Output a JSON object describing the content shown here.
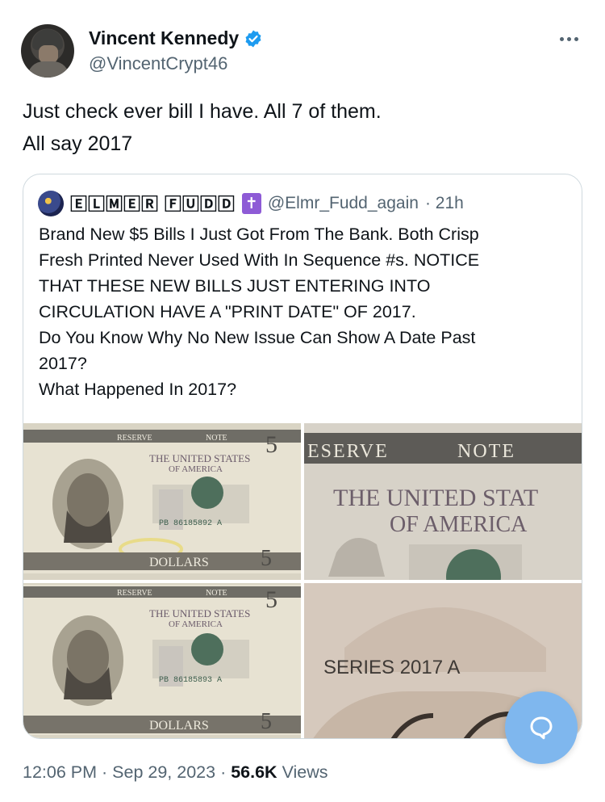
{
  "author": {
    "display_name": "Vincent Kennedy",
    "handle": "@VincentCrypt46",
    "verified": true,
    "verified_color": "#1d9bf0"
  },
  "tweet": {
    "lines": [
      "Just check ever bill I have. All 7 of them.",
      "All say 2017"
    ]
  },
  "quoted": {
    "display_name": "🄴🄻🄼🄴🅁 🄵🅄🄳🄳",
    "cross": "✝",
    "handle": "@Elmr_Fudd_again",
    "time": "· 21h",
    "lines": [
      "Brand New $5 Bills I Just Got From The Bank. Both Crisp",
      "Fresh Printed Never Used With In Sequence #s. NOTICE",
      "THAT THESE NEW BILLS JUST ENTERING INTO",
      "CIRCULATION HAVE A \"PRINT DATE\" OF 2017.",
      "Do You Know Why No New Issue Can Show A Date Past",
      "2017?",
      "What Happened In 2017?"
    ],
    "images": {
      "bill1_serial": "PB 86185892 A",
      "bill2_serial": "PB 86185893 A",
      "header_text": "THE UNITED STATES",
      "subheader_text": "OF AMERICA",
      "federal_reserve": "RESERVE",
      "note": "NOTE",
      "dollars": "DOLLARS",
      "five": "5",
      "zoom_title": "THE UNITED STAT",
      "zoom_subtitle": "OF AMERICA",
      "zoom_reserve": "ESERVE",
      "series_text": "SERIES 2017 A"
    }
  },
  "footer": {
    "time": "12:06 PM",
    "date": "Sep 29, 2023",
    "views_count": "56.6K",
    "views_label": "Views"
  },
  "icons": {
    "more": "more-icon",
    "verified": "verified-badge-icon",
    "compose": "chat-bubble-icon"
  },
  "colors": {
    "text": "#0f1419",
    "muted": "#536471",
    "border": "#cfd9de",
    "fab": "#7fb7ee"
  }
}
